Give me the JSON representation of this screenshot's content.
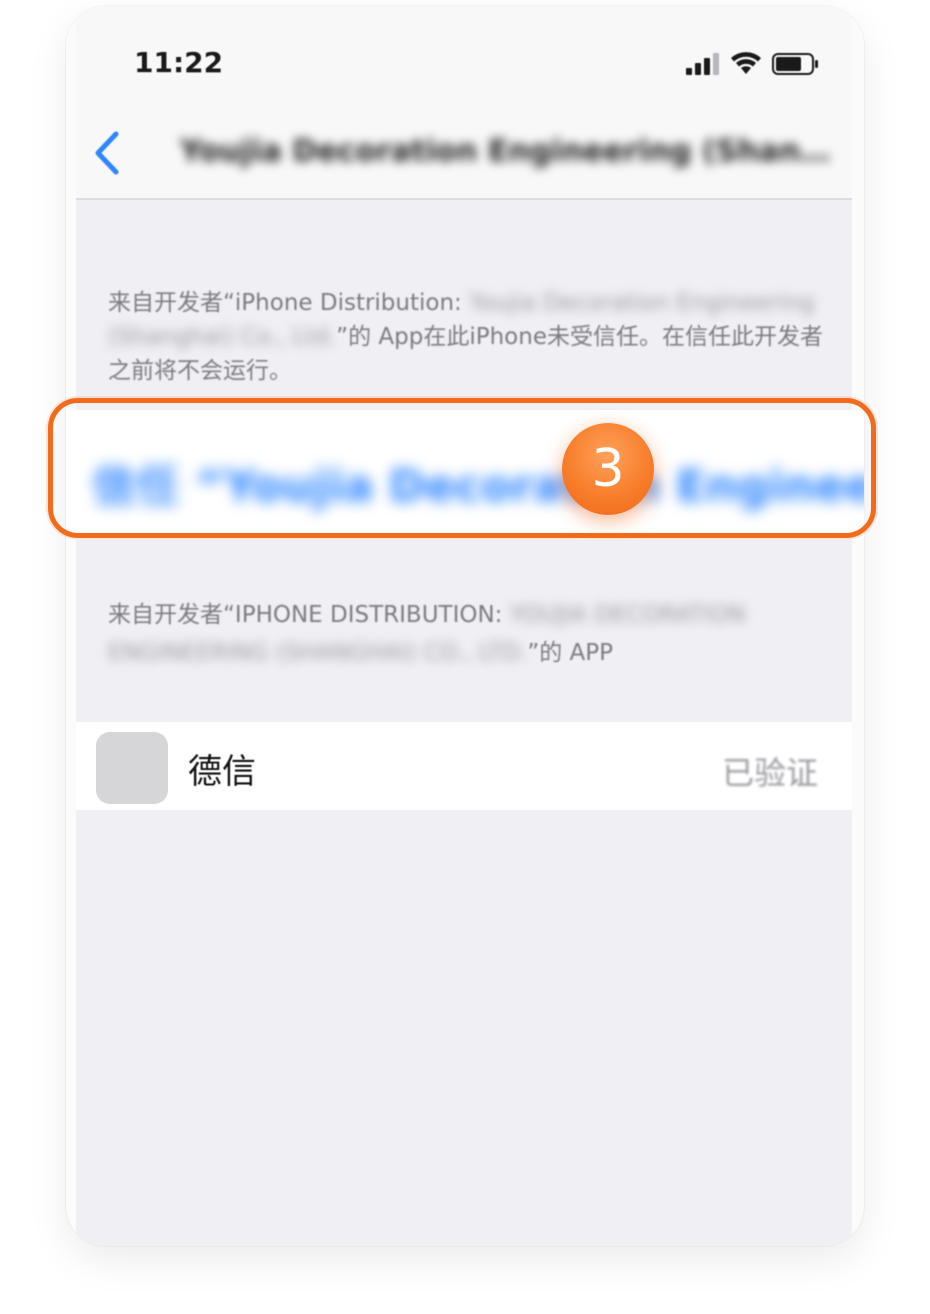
{
  "status_bar": {
    "time": "11:22",
    "icons": [
      "cellular-signal-icon",
      "wifi-icon",
      "battery-icon"
    ]
  },
  "nav": {
    "back_icon": "chevron-left-icon",
    "title": "Youjia Decoration Engineering (Shang..."
  },
  "description": {
    "prefix": "来自开发者“iPhone Distribution: ",
    "developer": "Youjia Decoration Engineering (Shanghai) Co., Ltd.",
    "suffix": "”的 App在此iPhone未受信任。在信任此开发者之前将不会运行。"
  },
  "trust_button": {
    "label": "信任 “Youjia Decoration Engineering (Shanghai) Co., Ltd.”"
  },
  "step_badge": {
    "number": "3"
  },
  "section": {
    "prefix": "来自开发者“iPhone Distribution: ",
    "developer": "YOUJIA DECORATION ENGINEERING (SHANGHAI) CO., LTD.",
    "suffix": "”的 APP"
  },
  "apps": [
    {
      "name": "德信",
      "status": "已验证",
      "icon": "app-placeholder-icon"
    }
  ],
  "colors": {
    "accent": "#2f86ff",
    "highlight": "#f26a1b",
    "background": "#efeff4"
  }
}
